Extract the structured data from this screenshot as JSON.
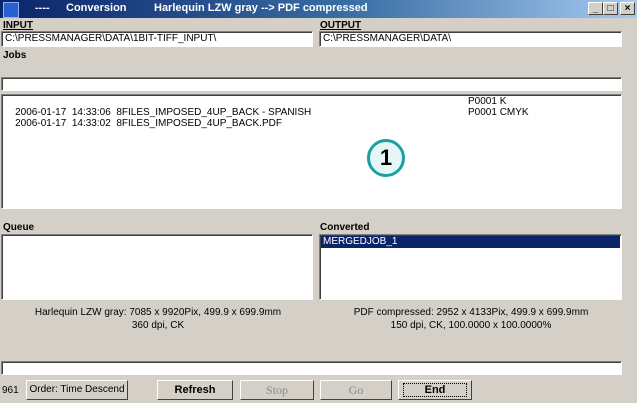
{
  "window": {
    "title_dashes": "----",
    "title_mode": "Conversion",
    "title_desc": "Harlequin LZW gray --> PDF compressed",
    "minimize_glyph": "_",
    "maximize_glyph": "□",
    "close_glyph": "×"
  },
  "input": {
    "label": "INPUT",
    "path": "C:\\PRESSMANAGER\\DATA\\1BIT-TIFF_INPUT\\"
  },
  "output": {
    "label": "OUTPUT",
    "path": "C:\\PRESSMANAGER\\DATA\\"
  },
  "jobs": {
    "label": "Jobs",
    "filter": "",
    "rows": [
      {
        "datetime": "2006-01-17  14:33:06",
        "name": "8FILES_IMPOSED_4UP_BACK - SPANISH",
        "plate": "P0001 K"
      },
      {
        "datetime": "2006-01-17  14:33:02",
        "name": "8FILES_IMPOSED_4UP_BACK.PDF",
        "plate": "P0001 CMYK"
      }
    ],
    "callout": "1"
  },
  "queue": {
    "label": "Queue",
    "items": []
  },
  "converted": {
    "label": "Converted",
    "items": [
      "MERGEDJOB_1"
    ]
  },
  "input_info": {
    "line1": "Harlequin LZW gray: 7085 x  9920Pix, 499.9 x 699.9mm",
    "line2": "360 dpi, CK"
  },
  "output_info": {
    "line1": "PDF compressed: 2952 x  4133Pix, 499.9 x 699.9mm",
    "line2": "150 dpi, CK, 100.0000 x 100.0000%"
  },
  "bottom": {
    "count": "961",
    "order": "Order: Time Descend",
    "refresh": "Refresh",
    "stop": "Stop",
    "go": "Go",
    "end": "End"
  }
}
